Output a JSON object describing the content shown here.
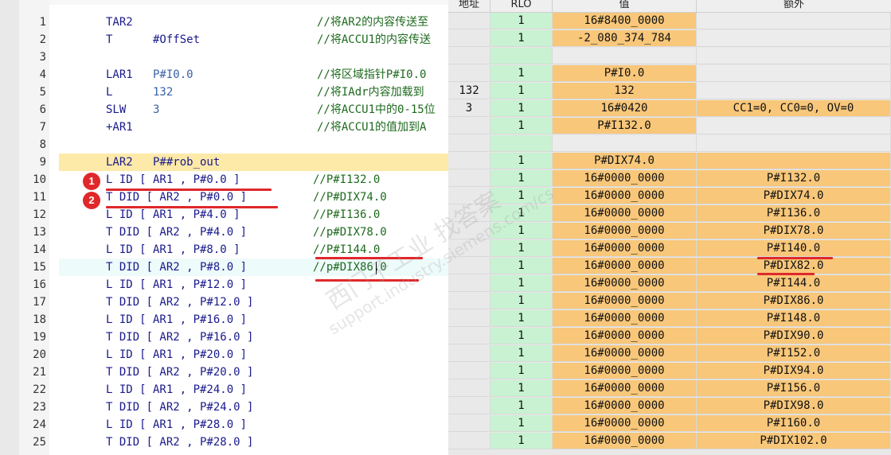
{
  "editor": {
    "lines": [
      {
        "n": "1",
        "ins": "TAR2",
        "op1": "",
        "op2": "",
        "comment": "//将AR2的内容传送至"
      },
      {
        "n": "2",
        "ins": "T",
        "op1": "#OffSet",
        "op2": "",
        "comment": "//将ACCU1的内容传送"
      },
      {
        "n": "3",
        "ins": "",
        "op1": "",
        "op2": "",
        "comment": ""
      },
      {
        "n": "4",
        "ins": "LAR1",
        "op1": "",
        "op2": "P#I0.0",
        "comment": "//将区域指针P#I0.0"
      },
      {
        "n": "5",
        "ins": "L",
        "op1": "",
        "op2": "132",
        "comment": "//将IAdr内容加载到"
      },
      {
        "n": "6",
        "ins": "SLW",
        "op1": "",
        "op2": "3",
        "comment": "//将ACCU1中的0-15位"
      },
      {
        "n": "7",
        "ins": "+AR1",
        "op1": "",
        "op2": "",
        "comment": "//将ACCU1的值加到A"
      },
      {
        "n": "8",
        "ins": "",
        "op1": "",
        "op2": "",
        "comment": ""
      },
      {
        "n": "9",
        "ins": "LAR2",
        "op1": "",
        "op2": "P##rob_out",
        "comment": ""
      },
      {
        "n": "10",
        "code": "L ID [ AR1 , P#0.0 ]",
        "comment": "//P#I132.0"
      },
      {
        "n": "11",
        "code": "T DID [ AR2 , P#0.0 ]",
        "comment": "//P#DIX74.0"
      },
      {
        "n": "12",
        "code": "L ID [ AR1 , P#4.0 ]",
        "comment": "//P#I136.0"
      },
      {
        "n": "13",
        "code": "T DID [ AR2 , P#4.0 ]",
        "comment": "//p#DIX78.0"
      },
      {
        "n": "14",
        "code": "L ID [ AR1 , P#8.0 ]",
        "comment": "//P#I144.0"
      },
      {
        "n": "15",
        "code": "T DID [ AR2 , P#8.0 ]",
        "comment": "//p#DIX86.0"
      },
      {
        "n": "16",
        "code": "L ID [ AR1 , P#12.0 ]",
        "comment": ""
      },
      {
        "n": "17",
        "code": "T DID [ AR2 , P#12.0 ]",
        "comment": ""
      },
      {
        "n": "18",
        "code": "L ID [ AR1 , P#16.0 ]",
        "comment": ""
      },
      {
        "n": "19",
        "code": "T DID [ AR2 , P#16.0 ]",
        "comment": ""
      },
      {
        "n": "20",
        "code": "L ID [ AR1 , P#20.0 ]",
        "comment": ""
      },
      {
        "n": "21",
        "code": "T DID [ AR2 , P#20.0 ]",
        "comment": ""
      },
      {
        "n": "22",
        "code": "L ID [ AR1 , P#24.0 ]",
        "comment": ""
      },
      {
        "n": "23",
        "code": "T DID [ AR2 , P#24.0 ]",
        "comment": ""
      },
      {
        "n": "24",
        "code": "L ID [ AR1 , P#28.0 ]",
        "comment": ""
      },
      {
        "n": "25",
        "code": "T DID [ AR2 , P#28.0 ]",
        "comment": ""
      }
    ],
    "badges": [
      "1",
      "2"
    ]
  },
  "grid": {
    "headers": {
      "addr": "地址",
      "rlo": "RLO",
      "value": "值",
      "extra": "额外"
    },
    "rows": [
      {
        "addr": "",
        "rlo": "1",
        "value": "16#8400_0000",
        "extra": ""
      },
      {
        "addr": "",
        "rlo": "1",
        "value": "-2_080_374_784",
        "extra": ""
      },
      {
        "addr": "",
        "rlo": "",
        "value": "",
        "extra": ""
      },
      {
        "addr": "",
        "rlo": "1",
        "value": "P#I0.0",
        "extra": ""
      },
      {
        "addr": "132",
        "rlo": "1",
        "value": "132",
        "extra": ""
      },
      {
        "addr": "3",
        "rlo": "1",
        "value": "16#0420",
        "extra": "CC1=0, CC0=0, OV=0"
      },
      {
        "addr": "",
        "rlo": "1",
        "value": "P#I132.0",
        "extra": ""
      },
      {
        "addr": "",
        "rlo": "",
        "value": "",
        "extra": ""
      },
      {
        "addr": "",
        "rlo": "1",
        "value": "P#DIX74.0",
        "extra": ""
      },
      {
        "addr": "",
        "rlo": "1",
        "value": "16#0000_0000",
        "extra": "P#I132.0"
      },
      {
        "addr": "",
        "rlo": "1",
        "value": "16#0000_0000",
        "extra": "P#DIX74.0"
      },
      {
        "addr": "",
        "rlo": "1",
        "value": "16#0000_0000",
        "extra": "P#I136.0"
      },
      {
        "addr": "",
        "rlo": "1",
        "value": "16#0000_0000",
        "extra": "P#DIX78.0"
      },
      {
        "addr": "",
        "rlo": "1",
        "value": "16#0000_0000",
        "extra": "P#I140.0"
      },
      {
        "addr": "",
        "rlo": "1",
        "value": "16#0000_0000",
        "extra": "P#DIX82.0"
      },
      {
        "addr": "",
        "rlo": "1",
        "value": "16#0000_0000",
        "extra": "P#I144.0"
      },
      {
        "addr": "",
        "rlo": "1",
        "value": "16#0000_0000",
        "extra": "P#DIX86.0"
      },
      {
        "addr": "",
        "rlo": "1",
        "value": "16#0000_0000",
        "extra": "P#I148.0"
      },
      {
        "addr": "",
        "rlo": "1",
        "value": "16#0000_0000",
        "extra": "P#DIX90.0"
      },
      {
        "addr": "",
        "rlo": "1",
        "value": "16#0000_0000",
        "extra": "P#I152.0"
      },
      {
        "addr": "",
        "rlo": "1",
        "value": "16#0000_0000",
        "extra": "P#DIX94.0"
      },
      {
        "addr": "",
        "rlo": "1",
        "value": "16#0000_0000",
        "extra": "P#I156.0"
      },
      {
        "addr": "",
        "rlo": "1",
        "value": "16#0000_0000",
        "extra": "P#DIX98.0"
      },
      {
        "addr": "",
        "rlo": "1",
        "value": "16#0000_0000",
        "extra": "P#I160.0"
      },
      {
        "addr": "",
        "rlo": "1",
        "value": "16#0000_0000",
        "extra": "P#DIX102.0"
      }
    ]
  },
  "watermark": {
    "text_cn": "西门子工业 找答案",
    "text_url": "support.industry.siemens.com/cs"
  },
  "colors": {
    "accent_red": "#e0282a",
    "rlo_green": "#c8f2d2",
    "value_orange": "#f8c77a",
    "highlight_line": "#fdeaa8"
  }
}
